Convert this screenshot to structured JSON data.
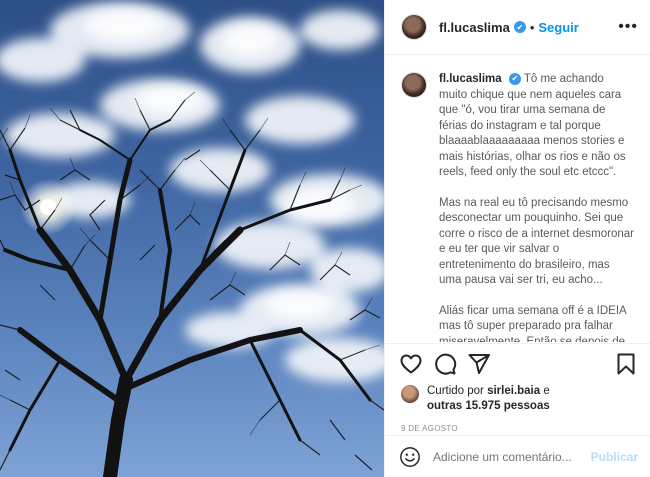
{
  "header": {
    "username": "fl.lucaslima",
    "verified_glyph": "✔",
    "separator": "•",
    "follow_label": "Seguir",
    "more_icon": "more-options-icon"
  },
  "caption": {
    "username": "fl.lucaslima",
    "paragraphs": [
      "Tô me achando muito chique que nem aqueles cara que \"ó, vou tirar uma semana de férias do instagram e tal porque blaaaablaaaaaaaaa menos stories e mais histórias, olhar os rios e não os reels, feed only the soul etc etccc\".",
      "Mas na real eu tô precisando mesmo desconectar um pouquinho. Sei que corre o risco de a internet desmoronar e eu ter que vir salvar o entretenimento do brasileiro, mas uma pausa vai ser tri, eu acho...",
      "Aliás ficar uma semana off é a IDEIA mas tô super preparado pra falhar miseravelmente. Então se depois de amanhã eu colar aqui falando"
    ]
  },
  "actions": {
    "icons": [
      "heart-icon",
      "comment-icon",
      "share-icon",
      "bookmark-icon"
    ]
  },
  "likes": {
    "prefix": "Curtido por ",
    "user": "sirlei.baia",
    "suffix": " e",
    "others": "outras 15.975 pessoas"
  },
  "date": "9 DE AGOSTO",
  "comment": {
    "placeholder": "Adicione um comentário...",
    "post_label": "Publicar"
  },
  "colors": {
    "accent": "#0095f6",
    "post_disabled": "#b2dffc",
    "verified": "#3897f0"
  }
}
